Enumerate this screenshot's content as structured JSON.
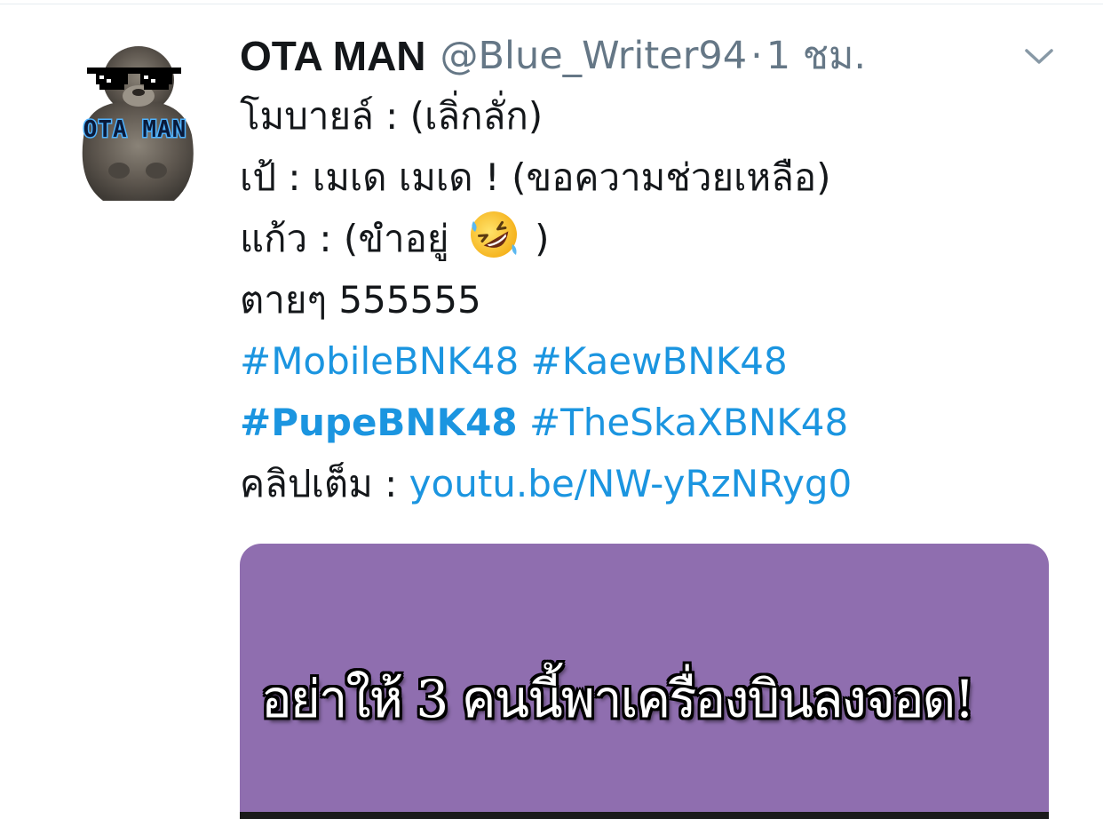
{
  "tweet": {
    "display_name": "OTA MAN",
    "handle": "@Blue_Writer94",
    "separator": "·",
    "time": "1 ชม.",
    "avatar_text": "OTA MAN",
    "lines": [
      "โมบายล์ : (เลิ่กลั่ก)",
      "เป้ : เมเด เมเด ! (ขอความช่วยเหลือ)"
    ],
    "line3_before": "แก้ว : (ขำอยู่",
    "line3_after": ")",
    "line4": "ตายๆ 555555",
    "hashtags_row1": [
      "#MobileBNK48",
      "#KaewBNK48"
    ],
    "hashtags_row2": [
      "#PupeBNK48",
      "#TheSkaXBNK48"
    ],
    "clip_label": "คลิปเต็ม : ",
    "clip_link": "youtu.be/NW-yRzNRyg0",
    "media_caption": "อย่าให้ 3 คนนี้พาเครื่องบินลงจอด!"
  },
  "colors": {
    "link": "#1b95e0",
    "secondary": "#657786",
    "media_bg": "#8f6eaf"
  },
  "icons": {
    "menu": "chevron-down-icon",
    "emoji": "rolling-on-floor-laughing-emoji"
  }
}
